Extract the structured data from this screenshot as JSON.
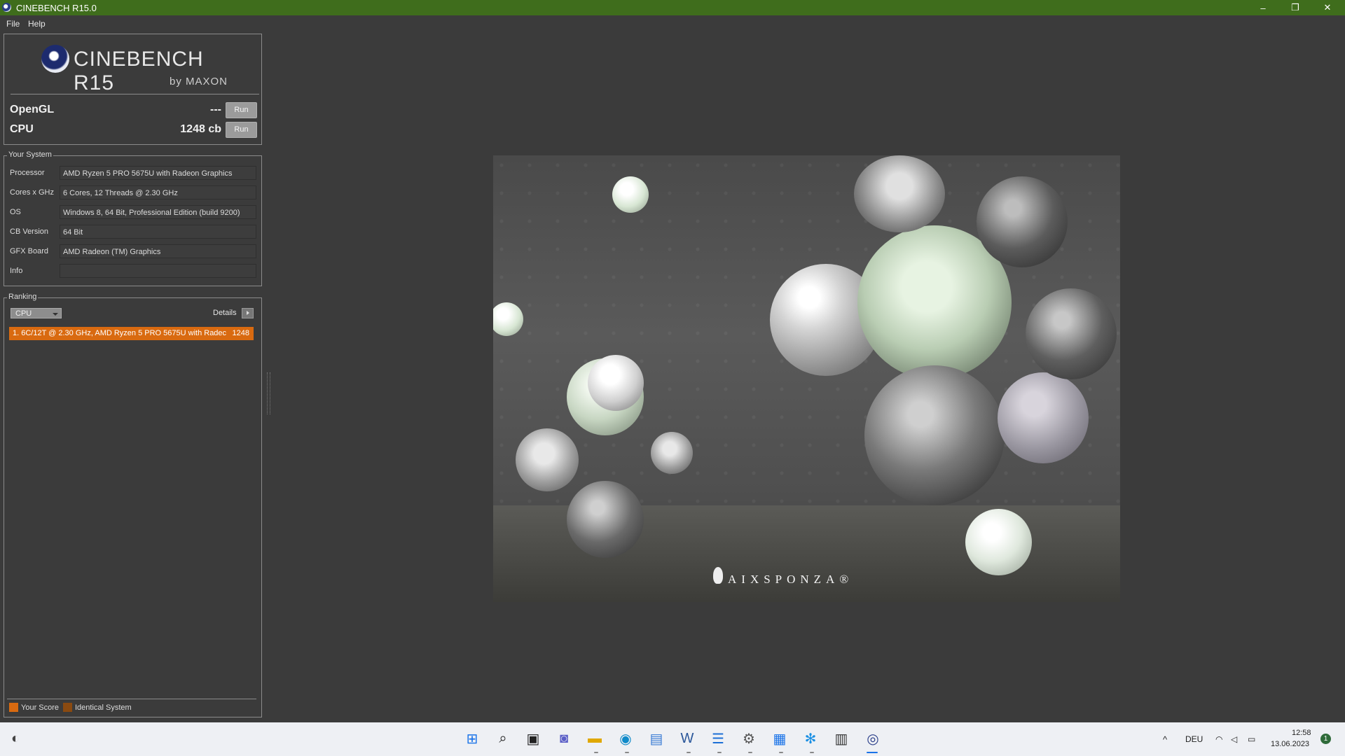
{
  "window": {
    "title": "CINEBENCH R15.0",
    "minimize": "–",
    "restore": "❐",
    "close": "✕"
  },
  "menu": {
    "file": "File",
    "help": "Help"
  },
  "logo": {
    "name": "CINEBENCH R15",
    "byline": "by MAXON"
  },
  "benchmarks": [
    {
      "label": "OpenGL",
      "value": "---",
      "button": "Run"
    },
    {
      "label": "CPU",
      "value": "1248 cb",
      "button": "Run"
    }
  ],
  "your_system": {
    "title": "Your System",
    "rows": [
      {
        "key": "Processor",
        "value": "AMD Ryzen 5 PRO 5675U with Radeon Graphics"
      },
      {
        "key": "Cores x GHz",
        "value": "6 Cores, 12 Threads @ 2.30 GHz"
      },
      {
        "key": "OS",
        "value": "Windows 8, 64 Bit, Professional Edition (build 9200)"
      },
      {
        "key": "CB Version",
        "value": "64 Bit"
      },
      {
        "key": "GFX Board",
        "value": "AMD Radeon (TM) Graphics"
      },
      {
        "key": "Info",
        "value": ""
      }
    ]
  },
  "ranking": {
    "title": "Ranking",
    "selected": "CPU",
    "details_label": "Details",
    "entries": [
      {
        "text": "1. 6C/12T @ 2.30 GHz, AMD Ryzen 5 PRO 5675U with Radec",
        "score": "1248"
      }
    ]
  },
  "legend": {
    "your_score": "Your Score",
    "identical_system": "Identical System",
    "your_score_color": "#d96a10",
    "identical_color": "#8a4a10"
  },
  "render": {
    "watermark": "AIXSPONZA®"
  },
  "taskbar": {
    "icons": [
      "start-icon",
      "search-icon",
      "task-view-icon",
      "chat-icon",
      "file-explorer-icon",
      "edge-icon",
      "photos-icon",
      "word-icon",
      "notepad-icon",
      "settings-icon",
      "remote-desktop-icon",
      "snowflake-app-icon",
      "store-icon",
      "cinebench-icon"
    ],
    "tray": {
      "language": "DEU",
      "time": "12:58",
      "date": "13.06.2023",
      "notifications": "1"
    }
  },
  "colors": {
    "titlebar": "#3f6d1c",
    "accent": "#d96a10",
    "background": "#3b3b3b"
  }
}
